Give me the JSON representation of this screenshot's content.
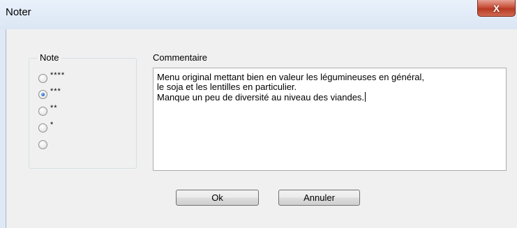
{
  "window": {
    "title": "Noter",
    "close_label": "X"
  },
  "rating": {
    "label": "Note",
    "options": [
      {
        "stars": "****",
        "selected": false
      },
      {
        "stars": "***",
        "selected": true
      },
      {
        "stars": "**",
        "selected": false
      },
      {
        "stars": "*",
        "selected": false
      },
      {
        "stars": "",
        "selected": false
      }
    ]
  },
  "comment": {
    "label": "Commentaire",
    "lines": [
      "Menu original mettant bien en valeur les légumineuses en général,",
      "le soja et les lentilles en particulier.",
      "Manque un peu de diversité au niveau des viandes."
    ]
  },
  "buttons": {
    "ok_label": "Ok",
    "cancel_label": "Annuler"
  }
}
